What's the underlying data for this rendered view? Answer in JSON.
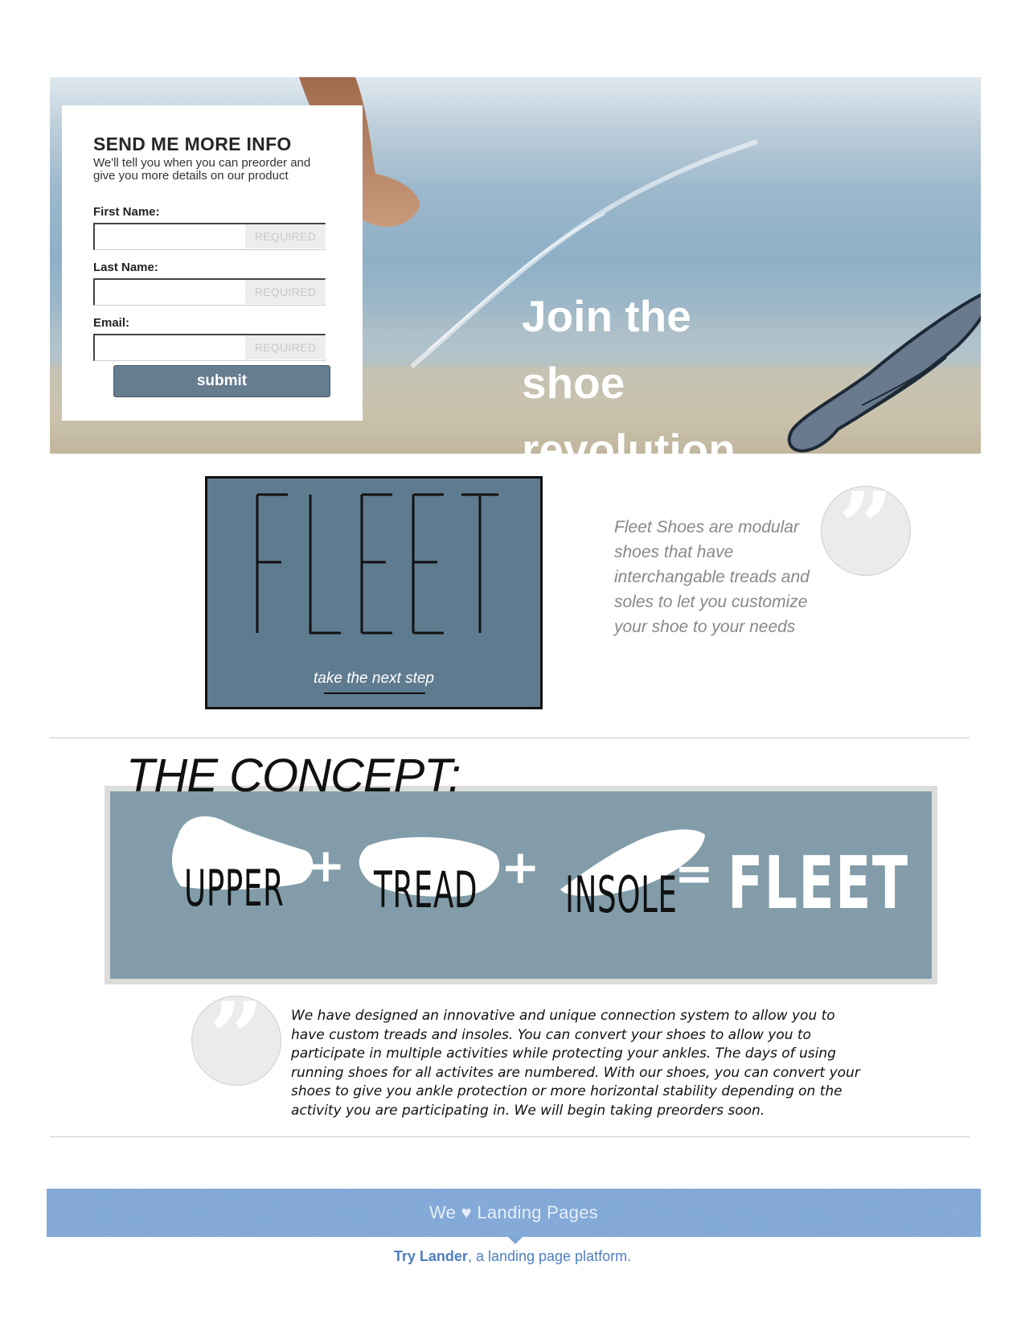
{
  "form": {
    "title": "SEND ME MORE INFO",
    "subtitle": "We'll tell you when you can preorder and give you more details on our product",
    "fields": [
      {
        "label": "First Name:",
        "badge": "REQUIRED",
        "value": ""
      },
      {
        "label": "Last Name:",
        "badge": "REQUIRED",
        "value": ""
      },
      {
        "label": "Email:",
        "badge": "REQUIRED",
        "value": ""
      }
    ],
    "submit_label": "submit"
  },
  "hero": {
    "headline_lines": [
      "Join the",
      "shoe",
      "revolution."
    ]
  },
  "logo": {
    "tagline": "take the next step"
  },
  "side_quote": "Fleet Shoes are modular shoes that have interchangable treads and soles to let you customize your shoe to your needs",
  "concept": {
    "title": "THE CONCEPT:",
    "parts": [
      "UPPER",
      "TREAD",
      "INSOLE"
    ],
    "plus": "+",
    "equals": "=",
    "result": "FLEET"
  },
  "description": "We have designed an innovative and unique connection system to allow you to have custom treads and insoles. You can convert your shoes to allow you to participate in multiple activities while protecting your ankles. The days of using running shoes for all activites are numbered. With our shoes, you can convert your shoes to give you ankle protection or more horizontal stability depending on the activity you are participating in. We will begin taking preorders soon.",
  "footer": {
    "banner_prefix": "We",
    "heart": "♥",
    "banner_suffix": "Landing Pages",
    "cta_link": "Try Lander",
    "cta_rest": ", a landing page platform."
  },
  "colors": {
    "brand_slate": "#5f7b90",
    "concept_bg": "#829da9",
    "footer_blue": "#7fa6d6",
    "button": "#667c8f"
  },
  "icons": [
    "quote-icon",
    "wing-icon"
  ]
}
